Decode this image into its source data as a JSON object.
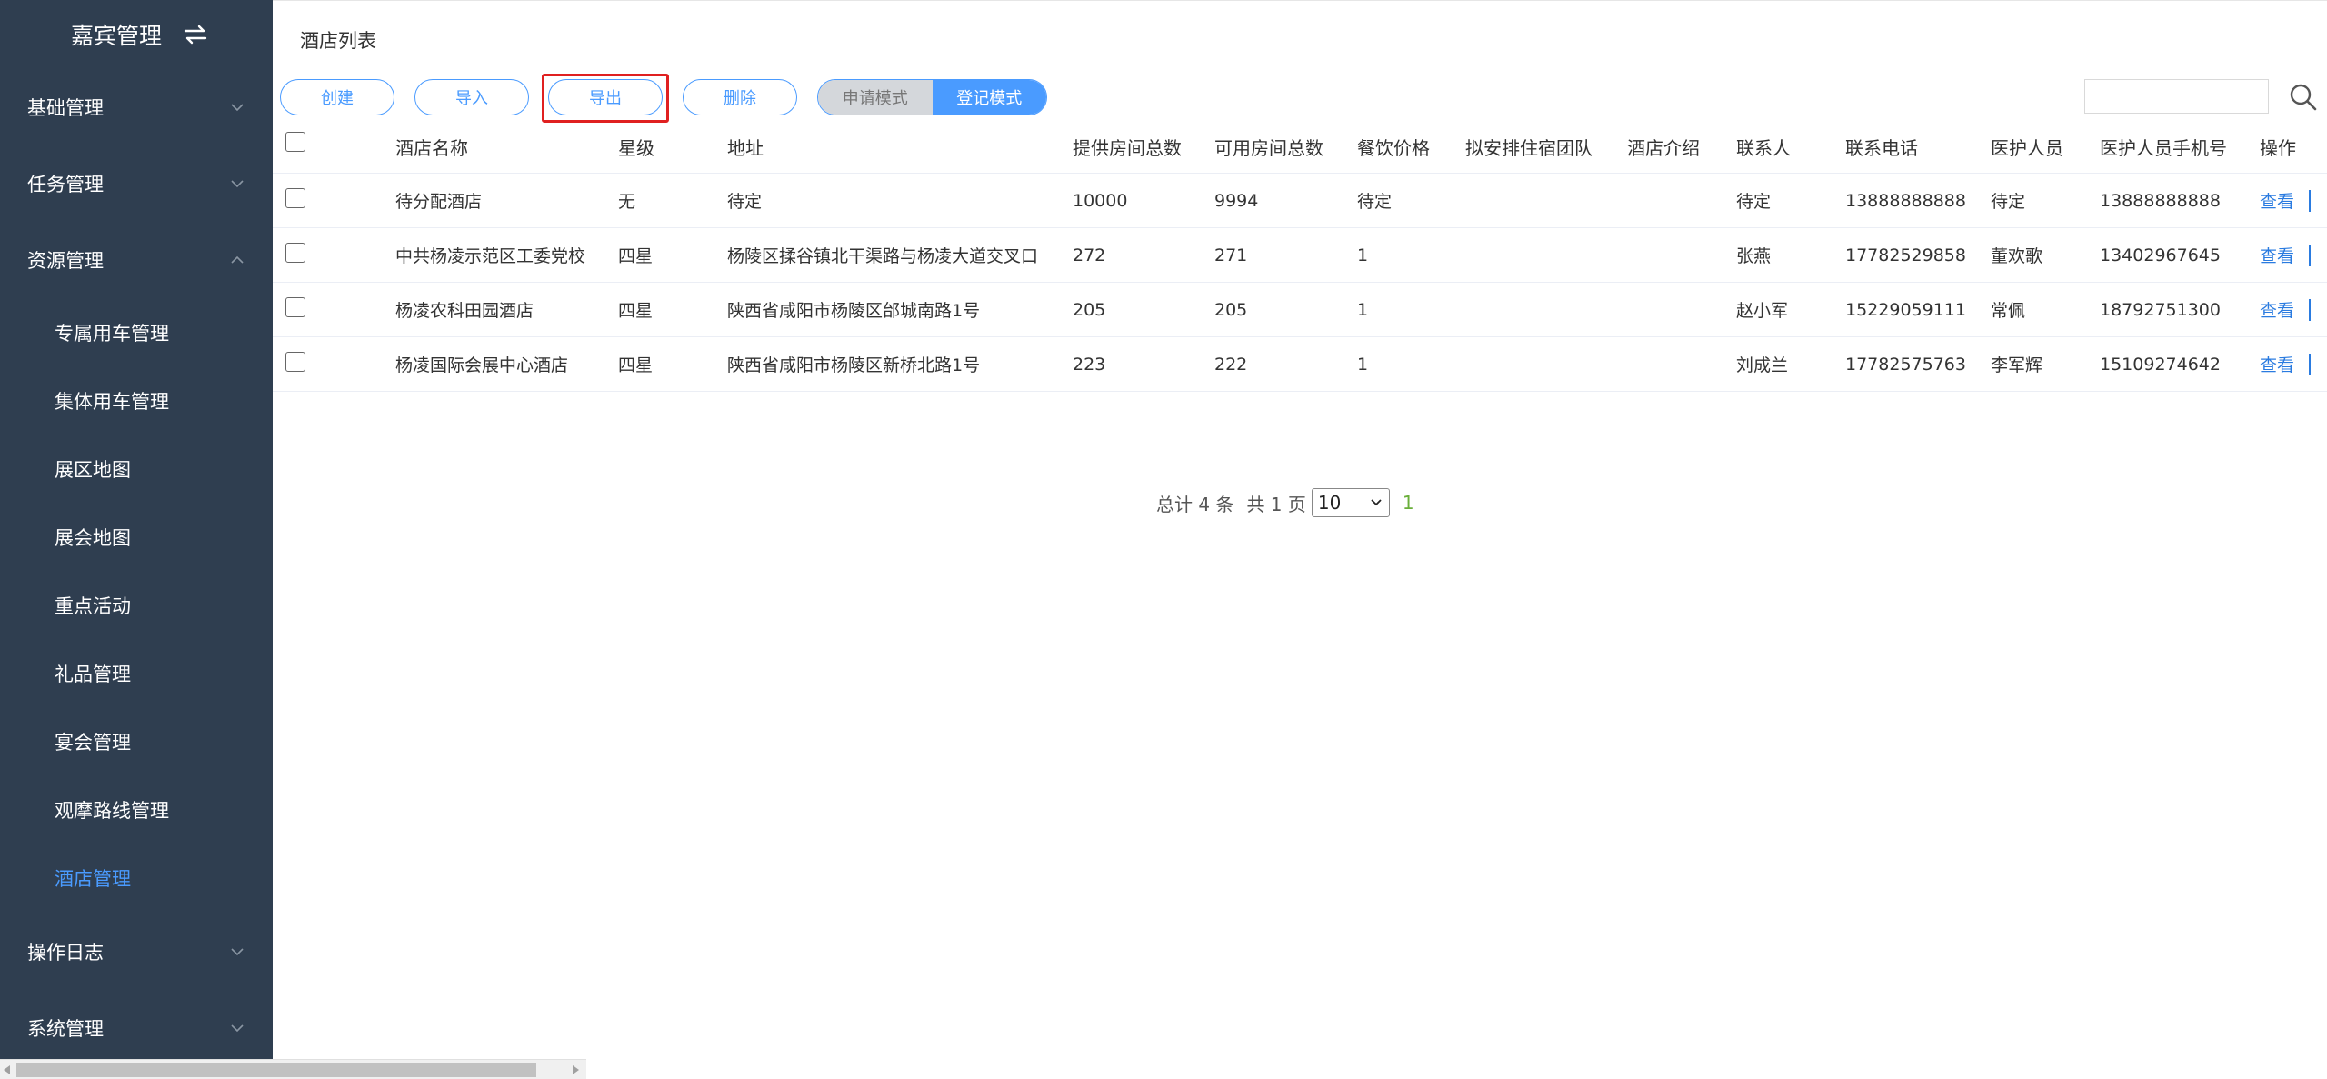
{
  "sidebar": {
    "title": "嘉宾管理",
    "items": [
      {
        "label": "基础管理",
        "type": "top",
        "chevron": "down"
      },
      {
        "label": "任务管理",
        "type": "top",
        "chevron": "down"
      },
      {
        "label": "资源管理",
        "type": "top",
        "chevron": "up"
      },
      {
        "label": "专属用车管理",
        "type": "sub"
      },
      {
        "label": "集体用车管理",
        "type": "sub"
      },
      {
        "label": "展区地图",
        "type": "sub"
      },
      {
        "label": "展会地图",
        "type": "sub"
      },
      {
        "label": "重点活动",
        "type": "sub"
      },
      {
        "label": "礼品管理",
        "type": "sub"
      },
      {
        "label": "宴会管理",
        "type": "sub"
      },
      {
        "label": "观摩路线管理",
        "type": "sub"
      },
      {
        "label": "酒店管理",
        "type": "sub",
        "active": true
      },
      {
        "label": "操作日志",
        "type": "top",
        "chevron": "down"
      },
      {
        "label": "系统管理",
        "type": "top",
        "chevron": "down"
      }
    ]
  },
  "page_title": "酒店列表",
  "toolbar": {
    "create": "创建",
    "import": "导入",
    "export": "导出",
    "delete": "删除"
  },
  "mode": {
    "apply": "申请模式",
    "register": "登记模式",
    "selected": "register"
  },
  "search": {
    "value": "",
    "placeholder": ""
  },
  "table": {
    "columns": [
      "酒店名称",
      "星级",
      "地址",
      "提供房间总数",
      "可用房间总数",
      "餐饮价格",
      "拟安排住宿团队",
      "酒店介绍",
      "联系人",
      "联系电话",
      "医护人员",
      "医护人员手机号",
      "操作"
    ],
    "rows": [
      [
        "待分配酒店",
        "无",
        "待定",
        "10000",
        "9994",
        "待定",
        "",
        "",
        "待定",
        "13888888888",
        "待定",
        "13888888888",
        "查看"
      ],
      [
        "中共杨凌示范区工委党校",
        "四星",
        "杨陵区揉谷镇北干渠路与杨凌大道交叉口",
        "272",
        "271",
        "1",
        "",
        "",
        "张燕",
        "17782529858",
        "董欢歌",
        "13402967645",
        "查看"
      ],
      [
        "杨凌农科田园酒店",
        "四星",
        "陕西省咸阳市杨陵区邰城南路1号",
        "205",
        "205",
        "1",
        "",
        "",
        "赵小军",
        "15229059111",
        "常佩",
        "18792751300",
        "查看"
      ],
      [
        "杨凌国际会展中心酒店",
        "四星",
        "陕西省咸阳市杨陵区新桥北路1号",
        "223",
        "222",
        "1",
        "",
        "",
        "刘成兰",
        "17782575763",
        "李军辉",
        "15109274642",
        "查看"
      ]
    ]
  },
  "pagination": {
    "total": "总计 4 条",
    "pages": "共 1 页",
    "page_size": "10",
    "current": "1"
  },
  "colors": {
    "sidebar_bg": "#2f3e50",
    "accent": "#4a9bff",
    "highlight": "#e02020",
    "link": "#2a7be0"
  }
}
